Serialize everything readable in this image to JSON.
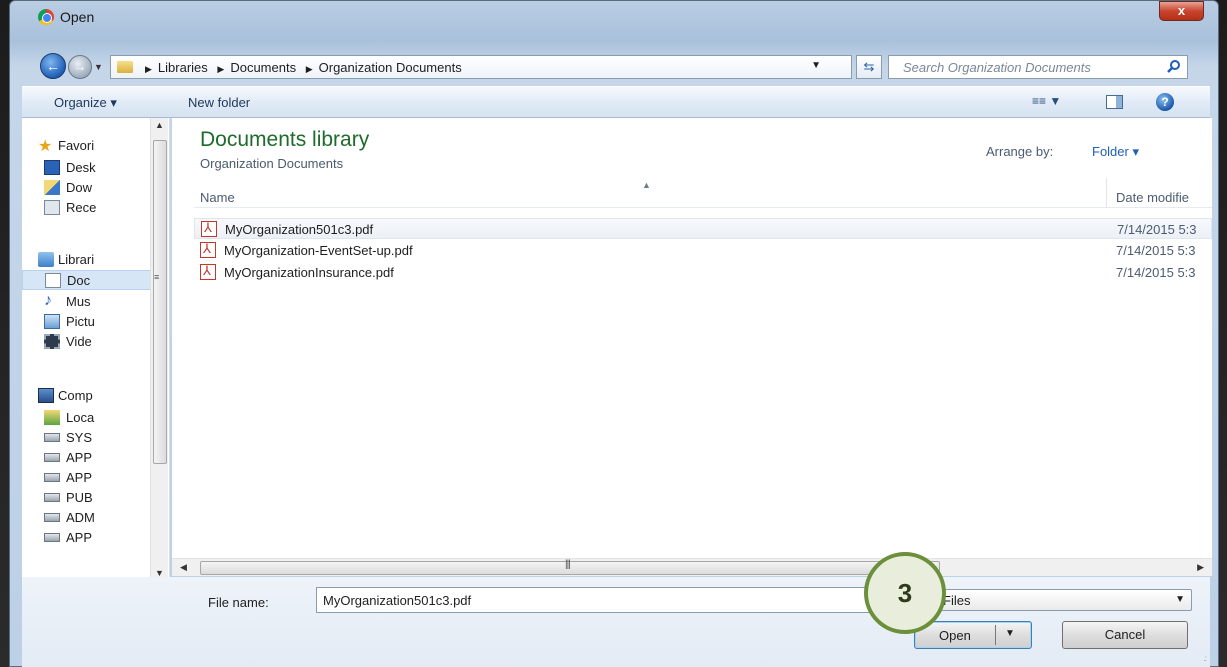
{
  "window": {
    "title": "Open",
    "close_label": "x"
  },
  "address": {
    "breadcrumbs": [
      "Libraries",
      "Documents",
      "Organization Documents"
    ],
    "search_placeholder": "Search Organization Documents"
  },
  "toolbar": {
    "organize_label": "Organize ▾",
    "new_folder_label": "New folder"
  },
  "sidebar": {
    "items": [
      {
        "label": "Favori",
        "icon": "star-icon"
      },
      {
        "label": "Desk",
        "icon": "desktop-icon"
      },
      {
        "label": "Dow",
        "icon": "downloads-icon"
      },
      {
        "label": "Rece",
        "icon": "recent-icon"
      },
      {
        "label": "Librari",
        "icon": "libraries-icon"
      },
      {
        "label": "Doc",
        "icon": "documents-icon"
      },
      {
        "label": "Mus",
        "icon": "music-icon"
      },
      {
        "label": "Pictu",
        "icon": "pictures-icon"
      },
      {
        "label": "Vide",
        "icon": "videos-icon"
      },
      {
        "label": "Comp",
        "icon": "computer-icon"
      },
      {
        "label": "Loca",
        "icon": "local-disk-icon"
      },
      {
        "label": "SYS",
        "icon": "network-drive-icon"
      },
      {
        "label": "APP",
        "icon": "network-drive-icon"
      },
      {
        "label": "APP",
        "icon": "network-drive-icon"
      },
      {
        "label": "PUB",
        "icon": "network-drive-icon"
      },
      {
        "label": "ADM",
        "icon": "network-drive-icon"
      },
      {
        "label": "APP",
        "icon": "network-drive-icon"
      }
    ]
  },
  "main": {
    "library_title": "Documents library",
    "library_subtitle": "Organization Documents",
    "arrange_label": "Arrange by:",
    "arrange_value": "Folder ▾",
    "columns": {
      "name": "Name",
      "date": "Date modifie"
    },
    "files": [
      {
        "name": "MyOrganization501c3.pdf",
        "date": "7/14/2015 5:3"
      },
      {
        "name": "MyOrganization-EventSet-up.pdf",
        "date": "7/14/2015 5:3"
      },
      {
        "name": "MyOrganizationInsurance.pdf",
        "date": "7/14/2015 5:3"
      }
    ]
  },
  "bottom": {
    "file_name_label": "File name:",
    "file_name_value": "MyOrganization501c3.pdf",
    "file_type_value": "Files",
    "open_label": "Open",
    "cancel_label": "Cancel"
  },
  "annotation": {
    "step_number": "3"
  },
  "colors": {
    "library_title": "#1e6b2b",
    "link": "#1f5fb5",
    "step_border": "#6c8f3b"
  }
}
